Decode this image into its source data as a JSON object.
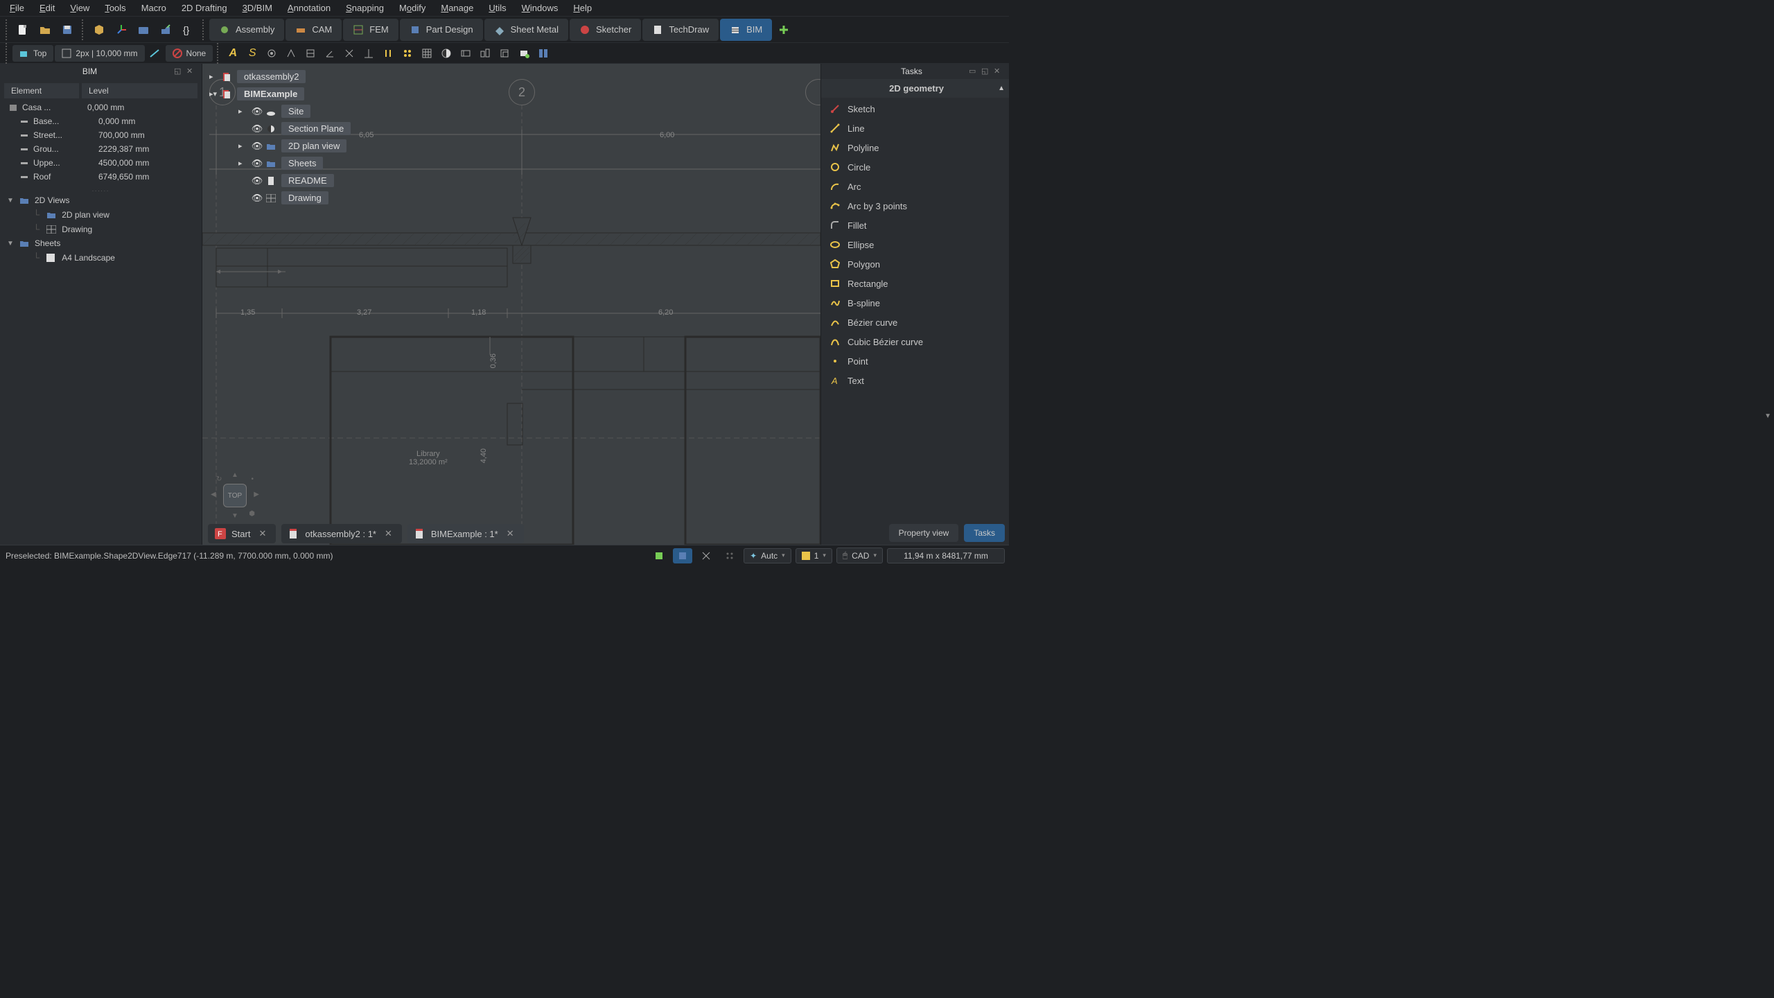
{
  "menubar": [
    "File",
    "Edit",
    "View",
    "Tools",
    "Macro",
    "2D Drafting",
    "3D/BIM",
    "Annotation",
    "Snapping",
    "Modify",
    "Manage",
    "Utils",
    "Windows",
    "Help"
  ],
  "workbenches": [
    {
      "label": "Assembly"
    },
    {
      "label": "CAM"
    },
    {
      "label": "FEM"
    },
    {
      "label": "Part Design"
    },
    {
      "label": "Sheet Metal"
    },
    {
      "label": "Sketcher"
    },
    {
      "label": "TechDraw"
    },
    {
      "label": "BIM",
      "active": true
    }
  ],
  "toolbar2": {
    "wp": "Top",
    "linewidth": "2px | 10,000 mm",
    "style": "None"
  },
  "left_panel": {
    "title": "BIM",
    "table": {
      "headers": [
        "Element",
        "Level"
      ],
      "rows": [
        {
          "name": "Casa ...",
          "val": "0,000 mm",
          "icon": "building"
        },
        {
          "name": "Base...",
          "val": "0,000 mm",
          "icon": "level"
        },
        {
          "name": "Street...",
          "val": "700,000 mm",
          "icon": "level"
        },
        {
          "name": "Grou...",
          "val": "2229,387 mm",
          "icon": "level"
        },
        {
          "name": "Uppe...",
          "val": "4500,000 mm",
          "icon": "level"
        },
        {
          "name": "Roof",
          "val": "6749,650 mm",
          "icon": "level"
        }
      ]
    },
    "tree": [
      {
        "label": "2D Views",
        "children": [
          {
            "label": "2D plan view"
          },
          {
            "label": "Drawing",
            "icon": "grid"
          }
        ]
      },
      {
        "label": "Sheets",
        "children": [
          {
            "label": "A4 Landscape",
            "icon": "sheet"
          }
        ]
      }
    ]
  },
  "model_tree": [
    {
      "label": "otkassembly2",
      "expand": true,
      "icon": "doc"
    },
    {
      "label": "BIMExample",
      "bold": true,
      "expand": true,
      "icon": "doc",
      "minus": true
    },
    {
      "label": "Site",
      "eye": true,
      "indent": 1,
      "icon": "site",
      "expand": true
    },
    {
      "label": "Section Plane",
      "eye": true,
      "indent": 1,
      "icon": "section"
    },
    {
      "label": "2D plan view",
      "eye": true,
      "indent": 1,
      "icon": "folder",
      "expand": true
    },
    {
      "label": "Sheets",
      "eye": true,
      "indent": 1,
      "icon": "folder",
      "expand": true
    },
    {
      "label": "README",
      "eye": true,
      "indent": 1,
      "icon": "file"
    },
    {
      "label": "Drawing",
      "eye": true,
      "indent": 1,
      "icon": "grid"
    }
  ],
  "grid_markers": [
    "1",
    "2"
  ],
  "dimensions": {
    "top_row": [
      "6,05",
      "6,00"
    ],
    "mid_row": [
      "1,35",
      "3,27",
      "1,18",
      "6,20"
    ],
    "v_dim": "0,36",
    "v_dim2": "4,40",
    "library": "Library",
    "lib_dim": "13,2000 m²"
  },
  "navcube": "TOP",
  "doc_tabs": [
    {
      "label": "Start",
      "icon": "freecad"
    },
    {
      "label": "otkassembly2 : 1*",
      "icon": "doc"
    },
    {
      "label": "BIMExample : 1*",
      "icon": "doc",
      "active": true
    }
  ],
  "right_panel": {
    "title": "Tasks",
    "section": "2D geometry",
    "tools": [
      "Sketch",
      "Line",
      "Polyline",
      "Circle",
      "Arc",
      "Arc by 3 points",
      "Fillet",
      "Ellipse",
      "Polygon",
      "Rectangle",
      "B-spline",
      "Bézier curve",
      "Cubic Bézier curve",
      "Point",
      "Text"
    ],
    "buttons": [
      "Property view",
      "Tasks"
    ]
  },
  "statusbar": {
    "message": "Preselected: BIMExample.Shape2DView.Edge717 (-11.289 m, 7700.000 mm, 0.000 mm)",
    "auto": "Autc",
    "layer": "1",
    "mode": "CAD",
    "coords": "11,94 m x 8481,77 mm"
  }
}
